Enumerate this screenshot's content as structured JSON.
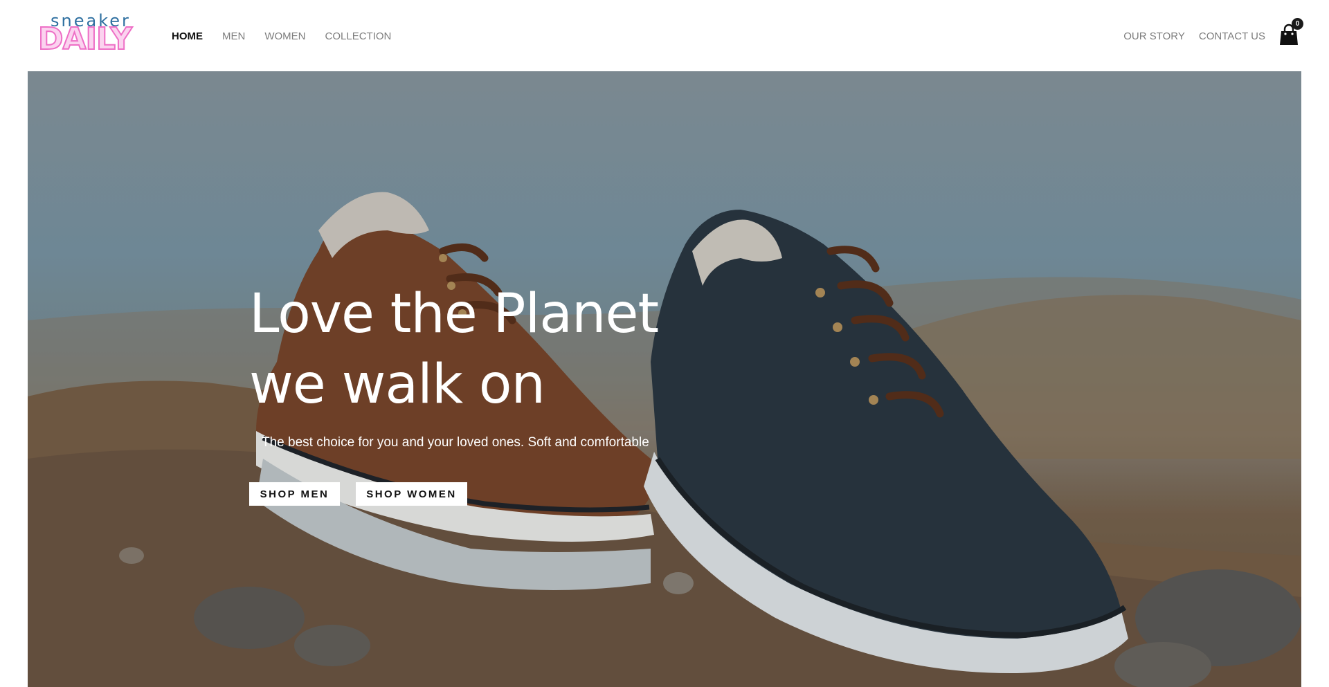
{
  "brand": {
    "logo_top": "sneaker",
    "logo_main": "DAILY",
    "colors": {
      "logo_top": "#2e6fa0",
      "logo_fill": "#fbd3ef",
      "logo_outline": "#ee6fc6"
    }
  },
  "nav": {
    "left": [
      {
        "label": "HOME",
        "active": true
      },
      {
        "label": "MEN",
        "active": false
      },
      {
        "label": "WOMEN",
        "active": false
      },
      {
        "label": "COLLECTION",
        "active": false
      }
    ],
    "right": [
      {
        "label": "OUR STORY"
      },
      {
        "label": "CONTACT US"
      }
    ]
  },
  "cart": {
    "icon": "shopping-bag-icon",
    "count": "0"
  },
  "hero": {
    "headline_line1": "Love the Planet",
    "headline_line2": "we walk on",
    "subtext": "The best choice for you and your loved ones. Soft and comfortable",
    "buttons": {
      "shop_men": "SHOP MEN",
      "shop_women": "SHOP WOMEN"
    }
  }
}
